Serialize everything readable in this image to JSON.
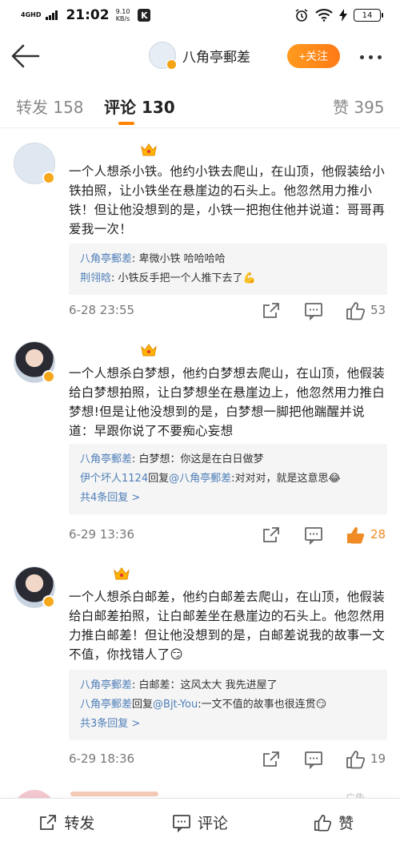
{
  "status_bar": {
    "network": "4GHD",
    "time": "21:02",
    "speed_value": "9.10",
    "speed_unit": "KB/s",
    "app_badge": "K",
    "battery": "14"
  },
  "nav": {
    "username": "八角亭郵差",
    "follow_label": "+关注"
  },
  "tabs": [
    {
      "label": "转发",
      "count": "158"
    },
    {
      "label": "评论",
      "count": "130"
    },
    {
      "label": "赞",
      "count": "395"
    }
  ],
  "comments": [
    {
      "text": "一个人想杀小铁。他约小铁去爬山，在山顶，他假装给小铁拍照，让小铁坐在悬崖边的石头上。他忽然用力推小铁！但让他没想到的是，小铁一把抱住他并说道：哥哥再爱我一次！",
      "replies": [
        {
          "name": "八角亭郵差",
          "text": ": 卑微小铁 哈哈哈哈"
        },
        {
          "name": "荆翎晗",
          "text": ": 小铁反手把一个人推下去了💪"
        }
      ],
      "more_replies": "",
      "date": "6-28 23:55",
      "likes": "53",
      "liked": false
    },
    {
      "text": "一个人想杀白梦想，他约白梦想去爬山，在山顶，他假装给白梦想拍照，让白梦想坐在悬崖边上，他忽然用力推白梦想!但是让他没想到的是，白梦想一脚把他踹醒并说道：早跟你说了不要痴心妄想",
      "replies": [
        {
          "name": "八角亭郵差",
          "text": ": 白梦想：你这是在白日做梦"
        },
        {
          "name": "伊个坏人1124",
          "text": "回复",
          "at": "@八角亭郵差",
          "tail": ":对对对，就是这意思😂"
        }
      ],
      "more_replies": "共4条回复 >",
      "date": "6-29 13:36",
      "likes": "28",
      "liked": true
    },
    {
      "text": "一个人想杀白邮差，他约白邮差去爬山，在山顶，他假装给白邮差拍照，让白邮差坐在悬崖边的石头上。他忽然用力推白邮差！但让他没想到的是，白邮差说我的故事一文不值，你找错人了😏",
      "replies": [
        {
          "name": "八角亭郵差",
          "text": ": 白邮差：这风太大 我先进屋了"
        },
        {
          "name": "八角亭郵差",
          "text": "回复",
          "at": "@Bjt-You",
          "tail": ":一文不值的故事也很连贯😏"
        }
      ],
      "more_replies": "共3条回复 >",
      "date": "6-29 18:36",
      "likes": "19",
      "liked": false
    }
  ],
  "peek_label": "广告",
  "bottom_bar": [
    {
      "label": "转发",
      "icon": "repost-icon"
    },
    {
      "label": "评论",
      "icon": "comment-icon"
    },
    {
      "label": "赞",
      "icon": "like-icon"
    }
  ],
  "colors": {
    "accent": "#ff8200",
    "link": "#4f7fb8",
    "liked": "#f08a24"
  }
}
